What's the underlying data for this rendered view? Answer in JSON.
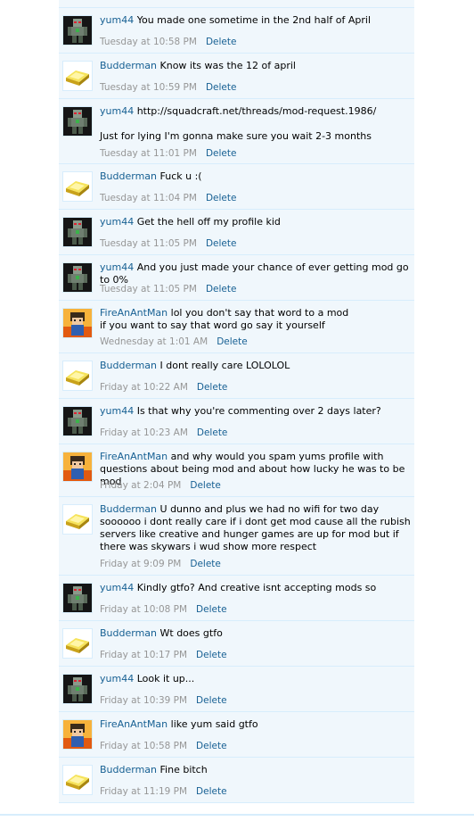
{
  "comments": [
    {
      "author": "",
      "text": "",
      "time": "",
      "delete": "",
      "avatar": "yum44-avatar",
      "height": 20
    },
    {
      "author": "yum44",
      "text": "You made one sometime in the 2nd half of April",
      "time": "Tuesday at 10:58 PM",
      "delete": "Delete",
      "avatar": "yum44-avatar"
    },
    {
      "author": "Budderman",
      "text": "Know its was the 12 of april",
      "time": "Tuesday at 10:59 PM",
      "delete": "Delete",
      "avatar": "gold-ingot-avatar"
    },
    {
      "author": "yum44",
      "text": "http://squadcraft.net/threads/mod-request.1986/\n\nJust for lying I'm gonna make sure you wait 2-3 months",
      "time": "Tuesday at 11:01 PM",
      "delete": "Delete",
      "avatar": "yum44-avatar"
    },
    {
      "author": "Budderman",
      "text": "Fuck u :(",
      "time": "Tuesday at 11:04 PM",
      "delete": "Delete",
      "avatar": "gold-ingot-avatar"
    },
    {
      "author": "yum44",
      "text": "Get the hell off my profile kid",
      "time": "Tuesday at 11:05 PM",
      "delete": "Delete",
      "avatar": "yum44-avatar"
    },
    {
      "author": "yum44",
      "text": "And you just made your chance of ever getting mod go to 0%",
      "time": "Tuesday at 11:05 PM",
      "delete": "Delete",
      "avatar": "yum44-avatar"
    },
    {
      "author": "FireAnAntMan",
      "text": "lol you don't say that word to a mod\nif you want to say that word go say it yourself",
      "time": "Wednesday at 1:01 AM",
      "delete": "Delete",
      "avatar": "fireanantman-avatar"
    },
    {
      "author": "Budderman",
      "text": "I dont really care LOLOLOL",
      "time": "Friday at 10:22 AM",
      "delete": "Delete",
      "avatar": "gold-ingot-avatar"
    },
    {
      "author": "yum44",
      "text": "Is that why you're commenting over 2 days later?",
      "time": "Friday at 10:23 AM",
      "delete": "Delete",
      "avatar": "yum44-avatar"
    },
    {
      "author": "FireAnAntMan",
      "text": "and why would you spam yums profile with questions about being mod and about how lucky he was to be mod",
      "time": "Friday at 2:04 PM",
      "delete": "Delete",
      "avatar": "fireanantman-avatar"
    },
    {
      "author": "Budderman",
      "text": "U dunno and plus we had no wifi for two day soooooo i dont really care if i dont get mod cause all the rubish servers like creative and hunger games are up for mod but if there was skywars i wud show more respect",
      "time": "Friday at 9:09 PM",
      "delete": "Delete",
      "avatar": "gold-ingot-avatar"
    },
    {
      "author": "yum44",
      "text": "Kindly gtfo? And creative isnt accepting mods so",
      "time": "Friday at 10:08 PM",
      "delete": "Delete",
      "avatar": "yum44-avatar"
    },
    {
      "author": "Budderman",
      "text": "Wt does gtfo",
      "time": "Friday at 10:17 PM",
      "delete": "Delete",
      "avatar": "gold-ingot-avatar"
    },
    {
      "author": "yum44",
      "text": "Look it up...",
      "time": "Friday at 10:39 PM",
      "delete": "Delete",
      "avatar": "yum44-avatar"
    },
    {
      "author": "FireAnAntMan",
      "text": "like yum said gtfo",
      "time": "Friday at 10:58 PM",
      "delete": "Delete",
      "avatar": "fireanantman-avatar"
    },
    {
      "author": "Budderman",
      "text": "Fine bitch",
      "time": "Friday at 11:19 PM",
      "delete": "Delete",
      "avatar": "gold-ingot-avatar"
    }
  ]
}
